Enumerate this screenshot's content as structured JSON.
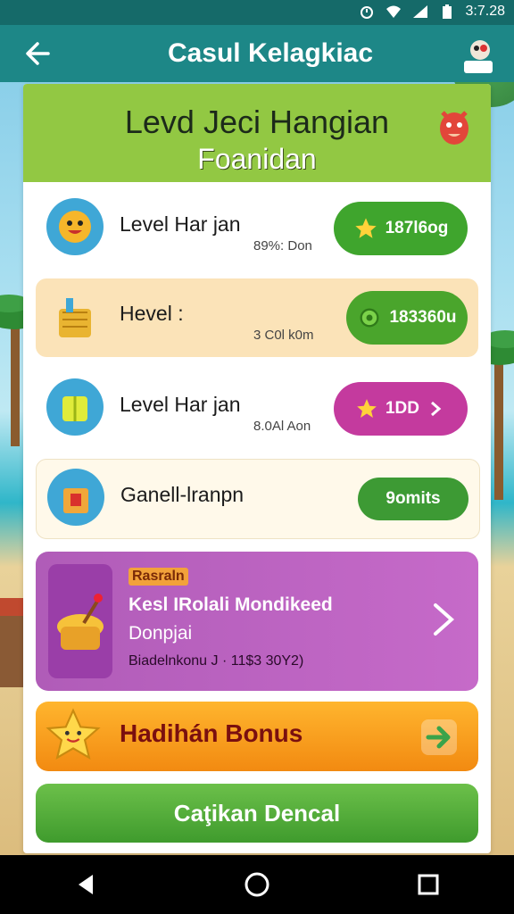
{
  "status_bar": {
    "time": "3:7.28"
  },
  "appbar": {
    "title": "Casul Kelagkiac"
  },
  "header": {
    "line1": "Levd Jeci Hangian",
    "line2": "Foanidan"
  },
  "rows": [
    {
      "title": "Level Har jan",
      "sub": "89%: Don",
      "pill": "187l6og",
      "pill_color": "#3fa52d"
    },
    {
      "title": "Hevel :",
      "sub": "3 C0l k0m",
      "pill": "183360u",
      "pill_color": "#4aa52c"
    },
    {
      "title": "Level Har jan",
      "sub": "8.0Al Aon",
      "pill": "1DD",
      "pill_color": "#c43a9e"
    },
    {
      "title": "Ganell-lranpn",
      "sub": "",
      "pill": "9omits",
      "pill_color": "#3d9a34"
    }
  ],
  "promo": {
    "tag": "Rasraln",
    "title": "Kesl IRolali Mondikeed",
    "subtitle": "Donpjai",
    "meta": "Biadelnkonu J · 11$3 30Y2)"
  },
  "bonus": {
    "label": "Hadihán Bonus"
  },
  "primary_button": {
    "label": "Caţikan Dencal"
  },
  "icons": {
    "back": "arrow-left-icon",
    "mascot": "mascot-icon",
    "star": "star-icon",
    "chevron": "chevron-right-icon"
  },
  "colors": {
    "appbar": "#1d8787",
    "header": "#92c843",
    "promo": "#c06ac4",
    "bonus": "#f5a21f",
    "primary": "#52ad39"
  }
}
